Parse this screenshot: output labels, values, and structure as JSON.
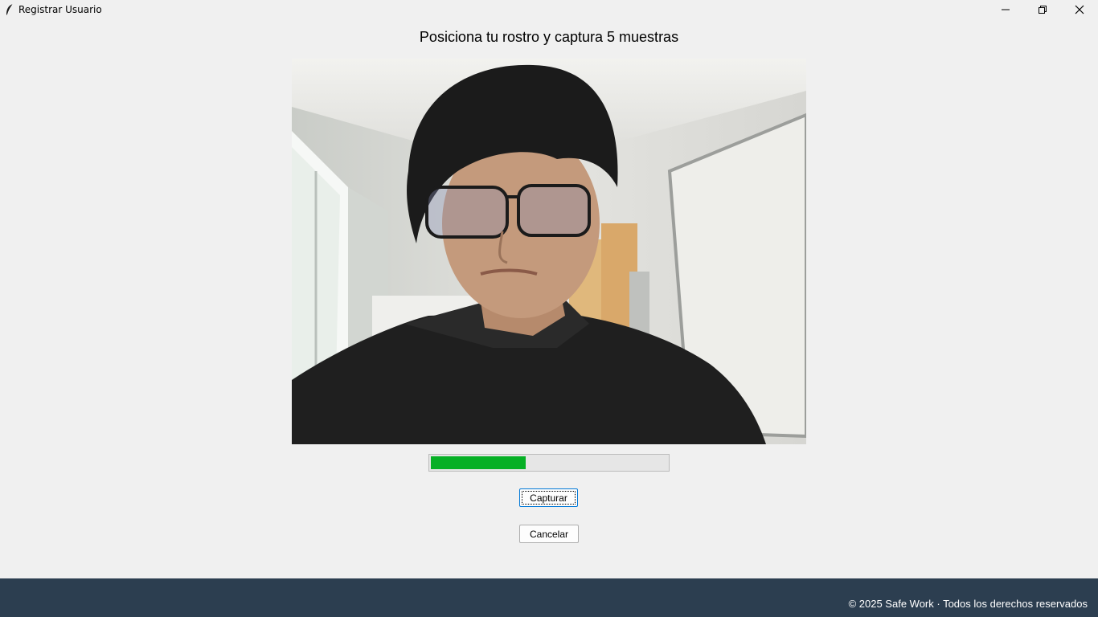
{
  "window": {
    "title": "Registrar Usuario",
    "app_icon": "feather-icon",
    "controls": [
      "minimize-icon",
      "restore-icon",
      "close-icon"
    ]
  },
  "main": {
    "heading": "Posiciona tu rostro y captura 5 muestras",
    "camera_feed": "webcam-preview",
    "progress": {
      "value": 0.4,
      "color": "#06b025"
    },
    "capture_label": "Capturar",
    "cancel_label": "Cancelar"
  },
  "footer": {
    "text": "© 2025 Safe Work · Todos los derechos reservados",
    "bg_color": "#2c3e50"
  }
}
